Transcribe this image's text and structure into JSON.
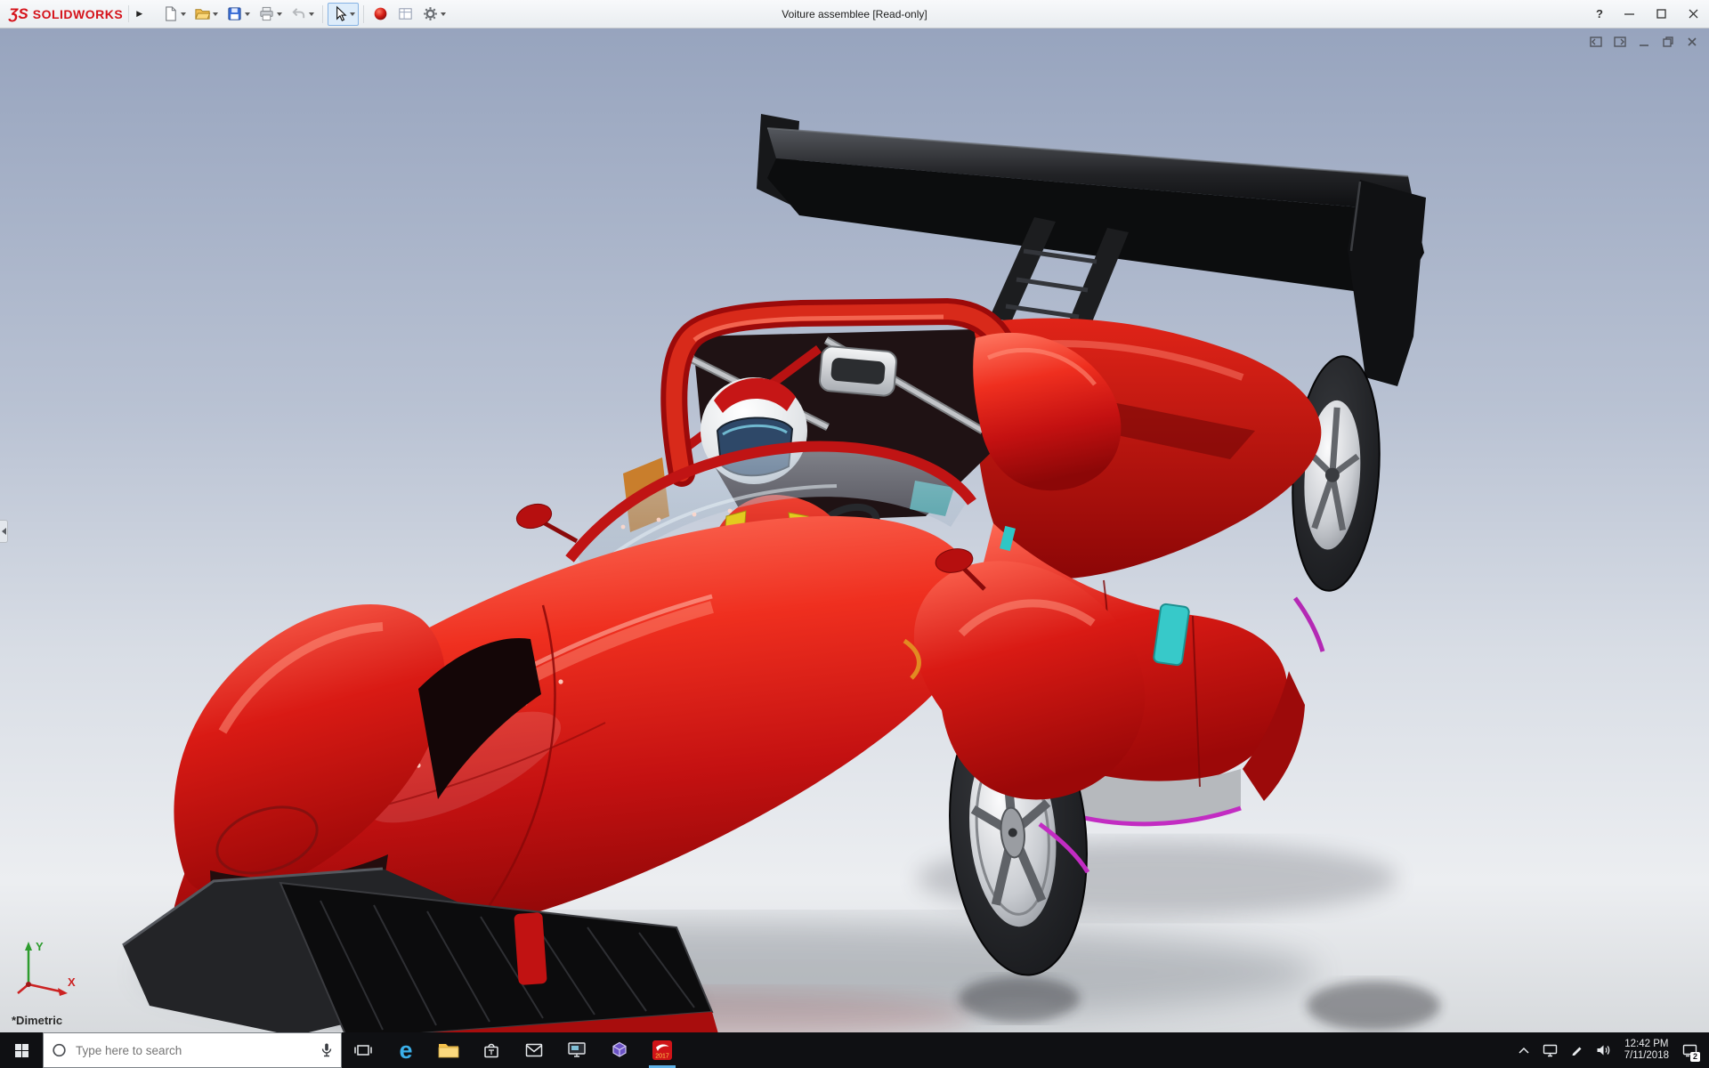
{
  "colors": {
    "car_red": "#d01616",
    "accent_teal": "#2fc6c6",
    "accent_magenta": "#c22cc2",
    "titlebar_bg": "#eef1f4",
    "taskbar_bg": "#0f1013",
    "viewport_gradient_top": "#98a6bf",
    "viewport_gradient_bottom": "#d9dcdf",
    "brand_red": "#d5121a"
  },
  "titlebar": {
    "logo_glyph": "ƷS",
    "brand": "SOLIDWORKS",
    "flyout_arrow": "▶",
    "document_title": "Voiture assemblee [Read-only]",
    "help_label": "?",
    "toolbar_items": [
      "new-document",
      "open",
      "save",
      "print",
      "undo",
      "select",
      "appearances",
      "drawing-sheet",
      "options"
    ]
  },
  "viewport": {
    "view_orientation_label": "*Dimetric",
    "triad": {
      "x_label": "X",
      "y_label": "Y"
    }
  },
  "taskbar": {
    "search_placeholder": "Type here to search",
    "edge_glyph": "e",
    "apps": [
      "task-view",
      "edge",
      "file-explorer",
      "store",
      "mail",
      "monitor-app",
      "3d-viewer",
      "solidworks"
    ],
    "solidworks_badge": "2017",
    "tray": {
      "time": "12:42 PM",
      "date": "7/11/2018",
      "notification_badge": "2"
    }
  }
}
